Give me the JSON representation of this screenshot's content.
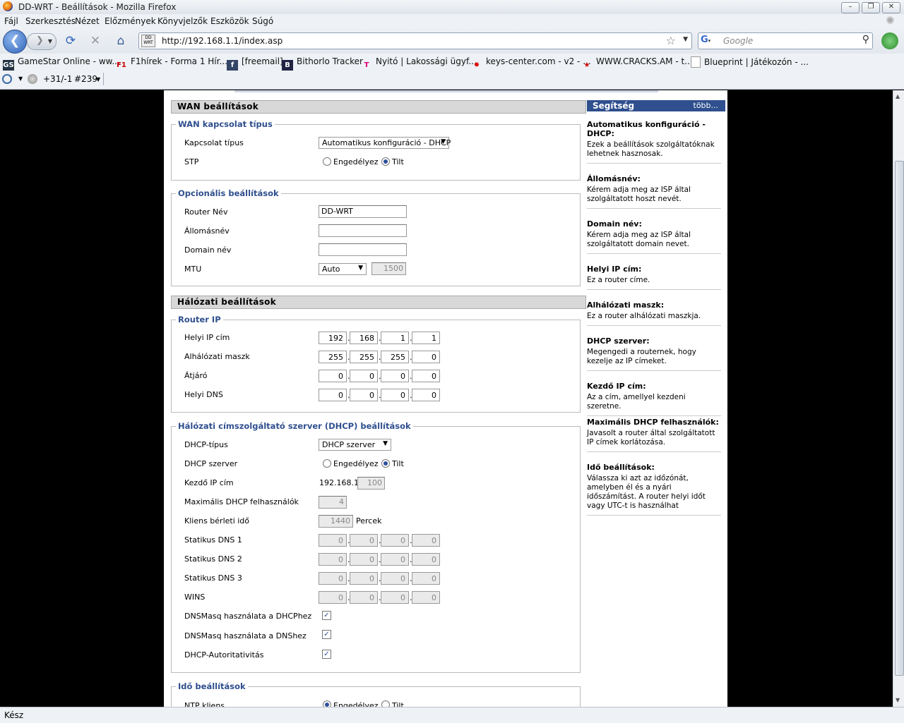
{
  "window": {
    "title": "DD-WRT - Beállítások - Mozilla Firefox",
    "menu": [
      "Fájl",
      "Szerkesztés",
      "Nézet",
      "Előzmények",
      "Könyvjelzők",
      "Eszközök",
      "Súgó"
    ],
    "url": "http://192.168.1.1/index.asp",
    "search_placeholder": "Google",
    "bookmarks": [
      "GameStar Online - ww...",
      "F1hírek - Forma 1 Hír...",
      "[freemail]",
      "Bithorlo Tracker",
      "Nyitó | Lakossági ügyf...",
      "keys-center.com - v2 - ...",
      "WWW.CRACKS.AM - t...",
      "Blueprint | Játékozón - ..."
    ],
    "addon": {
      "rank": "+31/-1",
      "count": "#239"
    },
    "status": "Kész"
  },
  "wan": {
    "header": "WAN beállítások",
    "conn": {
      "legend": "WAN kapcsolat típus",
      "type_label": "Kapcsolat típus",
      "type_value": "Automatikus konfiguráció - DHCP",
      "stp_label": "STP",
      "enable": "Engedélyez",
      "disable": "Tilt"
    },
    "opt": {
      "legend": "Opcionális beállítások",
      "router_name_label": "Router Név",
      "router_name_value": "DD-WRT",
      "hostname_label": "Állomásnév",
      "domain_label": "Domain név",
      "mtu_label": "MTU",
      "mtu_mode": "Auto",
      "mtu_value": "1500"
    }
  },
  "net": {
    "header": "Hálózati beállítások",
    "router_ip": {
      "legend": "Router IP",
      "rows": [
        {
          "label": "Helyi IP cím",
          "octets": [
            "192",
            "168",
            "1",
            "1"
          ]
        },
        {
          "label": "Alhálózati maszk",
          "octets": [
            "255",
            "255",
            "255",
            "0"
          ]
        },
        {
          "label": "Átjáró",
          "octets": [
            "0",
            "0",
            "0",
            "0"
          ]
        },
        {
          "label": "Helyi DNS",
          "octets": [
            "0",
            "0",
            "0",
            "0"
          ]
        }
      ]
    },
    "dhcp": {
      "legend": "Hálózati címszolgáltató szerver (DHCP) beállítások",
      "type_label": "DHCP-típus",
      "type_value": "DHCP szerver",
      "server_label": "DHCP szerver",
      "enable": "Engedélyez",
      "disable": "Tilt",
      "start_label": "Kezdő IP cím",
      "start_prefix": "192.168.1.",
      "start_value": "100",
      "max_label": "Maximális DHCP felhasználók",
      "max_value": "4",
      "lease_label": "Kliens bérleti idő",
      "lease_value": "1440",
      "lease_unit": "Percek",
      "static_rows": [
        {
          "label": "Statikus DNS 1",
          "octets": [
            "0",
            "0",
            "0",
            "0"
          ]
        },
        {
          "label": "Statikus DNS 2",
          "octets": [
            "0",
            "0",
            "0",
            "0"
          ]
        },
        {
          "label": "Statikus DNS 3",
          "octets": [
            "0",
            "0",
            "0",
            "0"
          ]
        },
        {
          "label": "WINS",
          "octets": [
            "0",
            "0",
            "0",
            "0"
          ]
        }
      ],
      "dnsmasq_dhcp_label": "DNSMasq használata a DHCPhez",
      "dnsmasq_dns_label": "DNSMasq használata a DNShez",
      "auth_label": "DHCP-Autoritativitás"
    },
    "time": {
      "legend": "Idő beállítások",
      "ntp_label": "NTP kliens",
      "enable": "Engedélyez",
      "disable": "Tilt"
    }
  },
  "help": {
    "title": "Segítség",
    "more": "több...",
    "items": [
      {
        "t": "Automatikus konfiguráció - DHCP:",
        "d": "Ezek a beállítások szolgáltatóknak lehetnek hasznosak."
      },
      {
        "t": "Állomásnév:",
        "d": "Kérem adja meg az ISP által szolgáltatott hoszt nevét."
      },
      {
        "t": "Domain név:",
        "d": "Kérem adja meg az ISP által szolgáltatott domain nevet."
      },
      {
        "t": "Helyi IP cím:",
        "d": "Ez a router címe."
      },
      {
        "t": "Alhálózati maszk:",
        "d": "Ez a router alhálózati maszkja."
      },
      {
        "t": "DHCP szerver:",
        "d": "Megengedi a routernek, hogy kezelje az IP címeket."
      },
      {
        "t": "Kezdő IP cím:",
        "d": "Az a cím, amellyel kezdeni szeretne."
      },
      {
        "t": "Maximális DHCP felhasználók:",
        "d": "Javasolt a router által szolgáltatott IP címek korlátozása."
      },
      {
        "t": "Idő beállítások:",
        "d": "Válassza ki azt az időzónát, amelyben él és a nyári időszámítást. A router helyi időt vagy UTC-t is használhat"
      }
    ]
  }
}
